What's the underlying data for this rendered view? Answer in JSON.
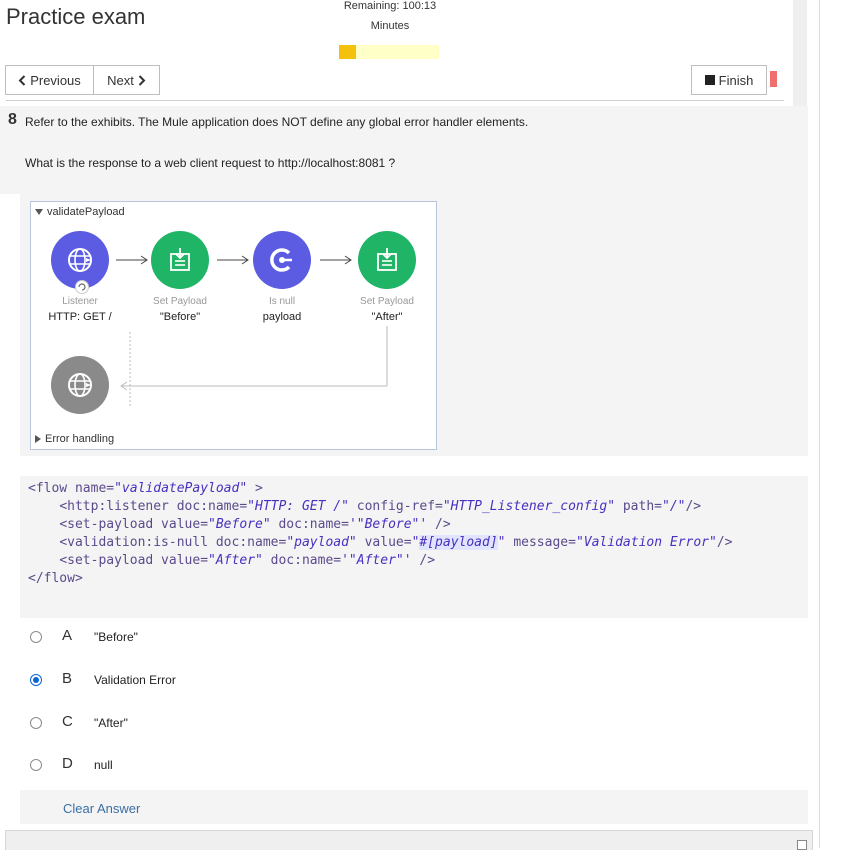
{
  "header": {
    "title": "Practice exam",
    "remaining": "Remaining: 100:13",
    "minutes": "Minutes",
    "progress_fraction": 0.17
  },
  "nav": {
    "previous": "Previous",
    "next": "Next",
    "finish": "Finish"
  },
  "question": {
    "number": "8",
    "text": "Refer to the exhibits. The Mule application does NOT define any global error handler elements.",
    "prompt": "What is the response to a web client request to http://localhost:8081 ?"
  },
  "exhibit": {
    "flow_name": "validatePayload",
    "nodes": [
      {
        "top": "Listener",
        "bottom": "HTTP: GET /"
      },
      {
        "top": "Set Payload",
        "bottom": "\"Before\""
      },
      {
        "top": "Is null",
        "bottom": "payload"
      },
      {
        "top": "Set Payload",
        "bottom": "\"After\""
      }
    ],
    "error_handling": "Error handling"
  },
  "code": {
    "flow_open_tag": "<flow",
    "flow_name_attr": " name=",
    "flow_name_val": "\"validatePayload\"",
    "flow_open_end": " >",
    "listener_tag": "<http:listener",
    "listener_attr1": " doc:name=",
    "listener_val1": "\"HTTP: GET /\"",
    "listener_attr2": " config-ref=",
    "listener_val2": "\"HTTP_Listener_config\"",
    "listener_attr3": " path=",
    "listener_val3": "\"/\"",
    "listener_end": "/>",
    "sp1_tag": "<set-payload",
    "sp1_attr1": " value=",
    "sp1_val1": "\"Before\"",
    "sp1_attr2": " doc:name=",
    "sp1_val2": "'\"Before\"'",
    "sp1_end": " />",
    "val_tag": "<validation:is-null",
    "val_attr1": " doc:name=",
    "val_val1": "\"payload\"",
    "val_attr2": " value=",
    "val_val2a": "\"",
    "val_val2b": "#[payload]",
    "val_val2c": "\"",
    "val_attr3": " message=",
    "val_val3": "\"Validation Error\"",
    "val_end": "/>",
    "sp2_tag": "<set-payload",
    "sp2_attr1": " value=",
    "sp2_val1": "\"After\"",
    "sp2_attr2": " doc:name=",
    "sp2_val2": "'\"After\"'",
    "sp2_end": " />",
    "flow_close": "</flow>"
  },
  "options": [
    {
      "letter": "A",
      "text": "\"Before\"",
      "selected": false
    },
    {
      "letter": "B",
      "text": "Validation Error",
      "selected": true
    },
    {
      "letter": "C",
      "text": "\"After\"",
      "selected": false
    },
    {
      "letter": "D",
      "text": "null",
      "selected": false
    }
  ],
  "clear_answer": "Clear Answer",
  "colors": {
    "listener": "#5b5ce2",
    "set_payload": "#1fb466",
    "is_null": "#5b5ce2",
    "error_node": "#8a8a8a",
    "timer_fill": "#f4c20d",
    "selected_radio": "#0a66d6"
  }
}
